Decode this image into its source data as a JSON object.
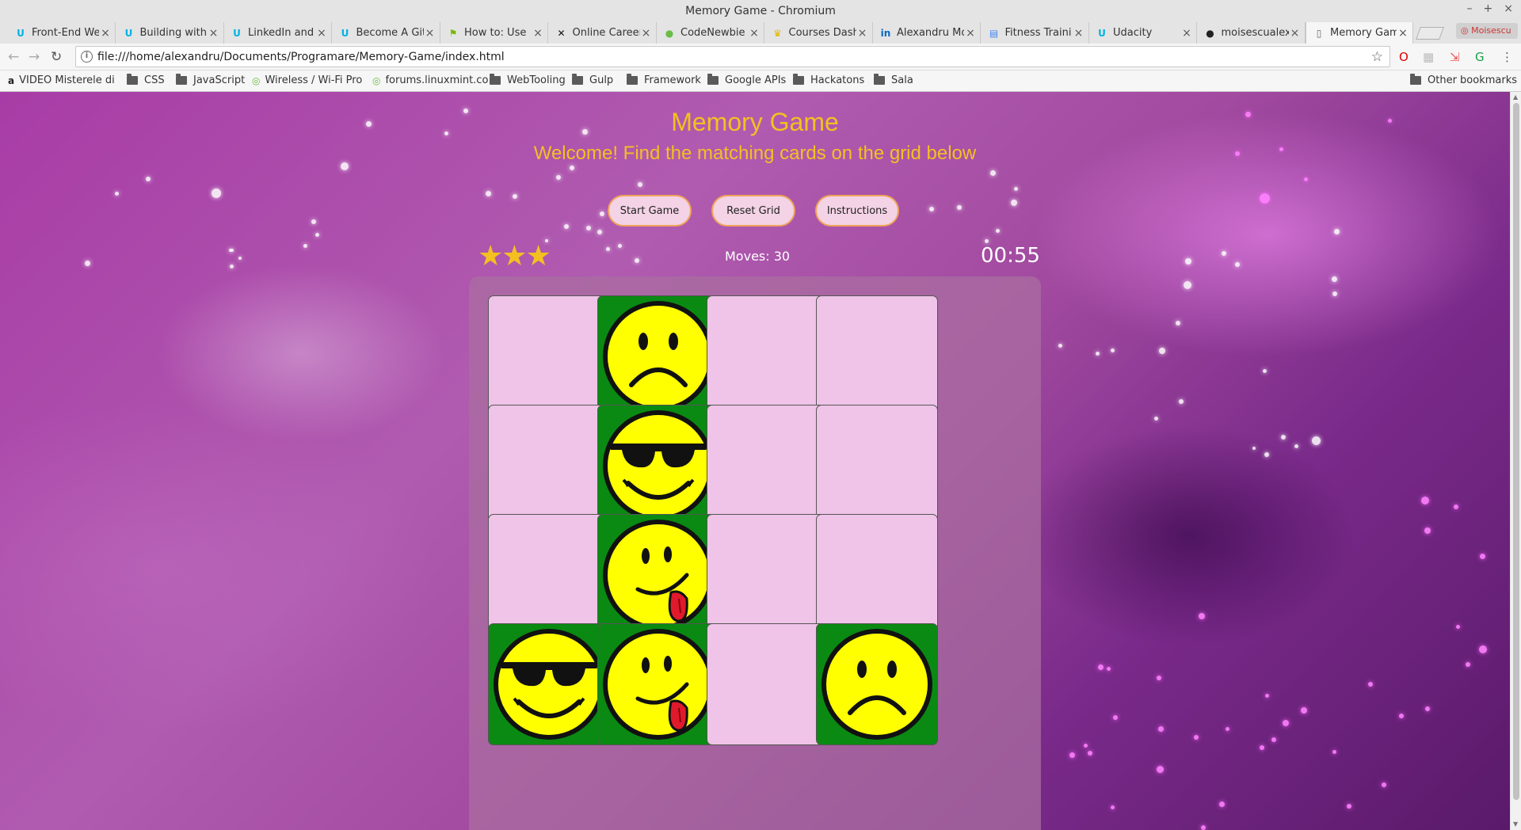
{
  "window": {
    "title": "Memory Game - Chromium",
    "controls": [
      "–",
      "+",
      "×"
    ]
  },
  "tabs": [
    {
      "label": "Front-End We",
      "icon": "udacity-icon",
      "glyph": "U",
      "color": "#02b3e4",
      "active": false
    },
    {
      "label": "Building with",
      "icon": "udacity-icon",
      "glyph": "U",
      "color": "#02b3e4",
      "active": false
    },
    {
      "label": "LinkedIn and",
      "icon": "udacity-icon",
      "glyph": "U",
      "color": "#02b3e4",
      "active": false
    },
    {
      "label": "Become A Git",
      "icon": "udacity-icon",
      "glyph": "U",
      "color": "#02b3e4",
      "active": false
    },
    {
      "label": "How to: Use",
      "icon": "flag-icon",
      "glyph": "⚑",
      "color": "#7ab800",
      "active": false
    },
    {
      "label": "Online Career",
      "icon": "x-logo-icon",
      "glyph": "✕",
      "color": "#111111",
      "active": false
    },
    {
      "label": "CodeNewbie",
      "icon": "codenewbie-icon",
      "glyph": "●",
      "color": "#6bbd45",
      "active": false
    },
    {
      "label": "Courses Dash",
      "icon": "crown-icon",
      "glyph": "♛",
      "color": "#e6b800",
      "active": false
    },
    {
      "label": "Alexandru Mo",
      "icon": "linkedin-icon",
      "glyph": "in",
      "color": "#0a66c2",
      "active": false
    },
    {
      "label": "Fitness Traini",
      "icon": "docs-icon",
      "glyph": "▤",
      "color": "#4285f4",
      "active": false
    },
    {
      "label": "Udacity",
      "icon": "udacity-icon",
      "glyph": "U",
      "color": "#02b3e4",
      "active": false
    },
    {
      "label": "moisescualex",
      "icon": "github-icon",
      "glyph": "●",
      "color": "#222222",
      "active": false
    },
    {
      "label": "Memory Gam",
      "icon": "file-icon",
      "glyph": "▯",
      "color": "#666666",
      "active": true
    }
  ],
  "profile": {
    "label": "Moisescu"
  },
  "address_bar": {
    "url": "file:///home/alexandru/Documents/Programare/Memory-Game/index.html"
  },
  "bookmarks": [
    {
      "label": "VIDEO Misterele di",
      "type": "link",
      "glyph": "a"
    },
    {
      "label": "CSS",
      "type": "folder"
    },
    {
      "label": "JavaScript",
      "type": "folder"
    },
    {
      "label": "Wireless / Wi-Fi Pro",
      "type": "link",
      "glyph": "◎"
    },
    {
      "label": "forums.linuxmint.co",
      "type": "link",
      "glyph": "◎"
    },
    {
      "label": "WebTooling",
      "type": "folder"
    },
    {
      "label": "Gulp",
      "type": "folder"
    },
    {
      "label": "Framework",
      "type": "folder"
    },
    {
      "label": "Google APIs",
      "type": "folder"
    },
    {
      "label": "Hackatons",
      "type": "folder"
    },
    {
      "label": "Sala",
      "type": "folder"
    }
  ],
  "other_bookmarks": "Other bookmarks",
  "game": {
    "title": "Memory Game",
    "subtitle": "Welcome! Find the matching cards on the grid below",
    "buttons": {
      "start": "Start Game",
      "reset": "Reset Grid",
      "instructions": "Instructions"
    },
    "stars": "★★★",
    "moves": "Moves: 30",
    "timer": "00:55",
    "grid": [
      [
        "hidden",
        "sad",
        "hidden",
        "hidden"
      ],
      [
        "hidden",
        "cool",
        "hidden",
        "hidden"
      ],
      [
        "hidden",
        "tongue",
        "hidden",
        "hidden"
      ],
      [
        "cool",
        "tongue",
        "hidden",
        "sad"
      ]
    ]
  },
  "colors": {
    "accent": "#f4c021",
    "card_back": "#efc4e8",
    "card_open": "#0a8a12",
    "button_bg": "#f3d3e5",
    "button_border": "#f0a35a"
  }
}
